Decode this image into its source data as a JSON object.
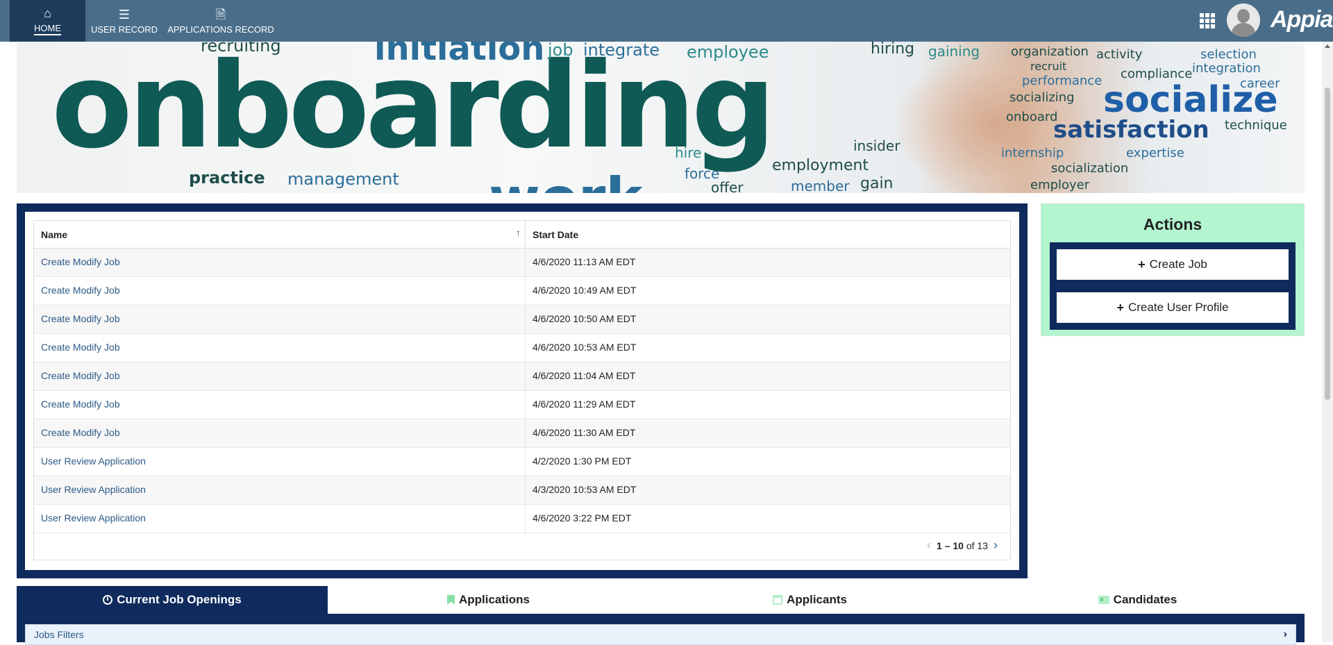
{
  "nav": {
    "tabs": [
      {
        "label": "HOME",
        "icon": "home-icon",
        "active": true
      },
      {
        "label": "USER RECORD",
        "icon": "list-icon",
        "active": false
      },
      {
        "label": "APPLICATIONS RECORD",
        "icon": "document-icon",
        "active": false
      }
    ],
    "brand": "Appian"
  },
  "banner": {
    "words": [
      "onboarding",
      "initiation",
      "job",
      "integrate",
      "employee",
      "recruiting",
      "hiring",
      "gaining",
      "organization",
      "activity",
      "selection",
      "integration",
      "recruit",
      "compliance",
      "career",
      "performance",
      "socialize",
      "socializing",
      "onboard",
      "technique",
      "satisfaction",
      "insider",
      "hire",
      "force",
      "internship",
      "expertise",
      "practice",
      "management",
      "work",
      "offer",
      "employment",
      "member",
      "gain",
      "socialization",
      "employer"
    ]
  },
  "task_grid": {
    "columns": [
      "Name",
      "Start Date"
    ],
    "rows": [
      {
        "name": "Create Modify Job",
        "start": "4/6/2020 11:13 AM EDT"
      },
      {
        "name": "Create Modify Job",
        "start": "4/6/2020 10:49 AM EDT"
      },
      {
        "name": "Create Modify Job",
        "start": "4/6/2020 10:50 AM EDT"
      },
      {
        "name": "Create Modify Job",
        "start": "4/6/2020 10:53 AM EDT"
      },
      {
        "name": "Create Modify Job",
        "start": "4/6/2020 11:04 AM EDT"
      },
      {
        "name": "Create Modify Job",
        "start": "4/6/2020 11:29 AM EDT"
      },
      {
        "name": "Create Modify Job",
        "start": "4/6/2020 11:30 AM EDT"
      },
      {
        "name": "User Review Application",
        "start": "4/2/2020 1:30 PM EDT"
      },
      {
        "name": "User Review Application",
        "start": "4/3/2020 10:53 AM EDT"
      },
      {
        "name": "User Review Application",
        "start": "4/6/2020 3:22 PM EDT"
      }
    ],
    "pager": {
      "range": "1 – 10",
      "of_label": "of",
      "total": "13"
    }
  },
  "actions": {
    "title": "Actions",
    "buttons": [
      "Create Job",
      "Create User Profile"
    ]
  },
  "bottom_tabs": [
    {
      "label": "Current Job Openings",
      "icon": "clock-icon",
      "active": true
    },
    {
      "label": "Applications",
      "icon": "bookmark-icon",
      "active": false
    },
    {
      "label": "Applicants",
      "icon": "calendar-icon",
      "active": false
    },
    {
      "label": "Candidates",
      "icon": "id-card-icon",
      "active": false
    }
  ],
  "filters": {
    "label": "Jobs Filters"
  },
  "colors": {
    "topbar": "#4a6e8a",
    "topbar_active": "#1d3c5c",
    "navy": "#0f2a5c",
    "link": "#2d5a86",
    "actions_bg": "#b3f5cf"
  }
}
